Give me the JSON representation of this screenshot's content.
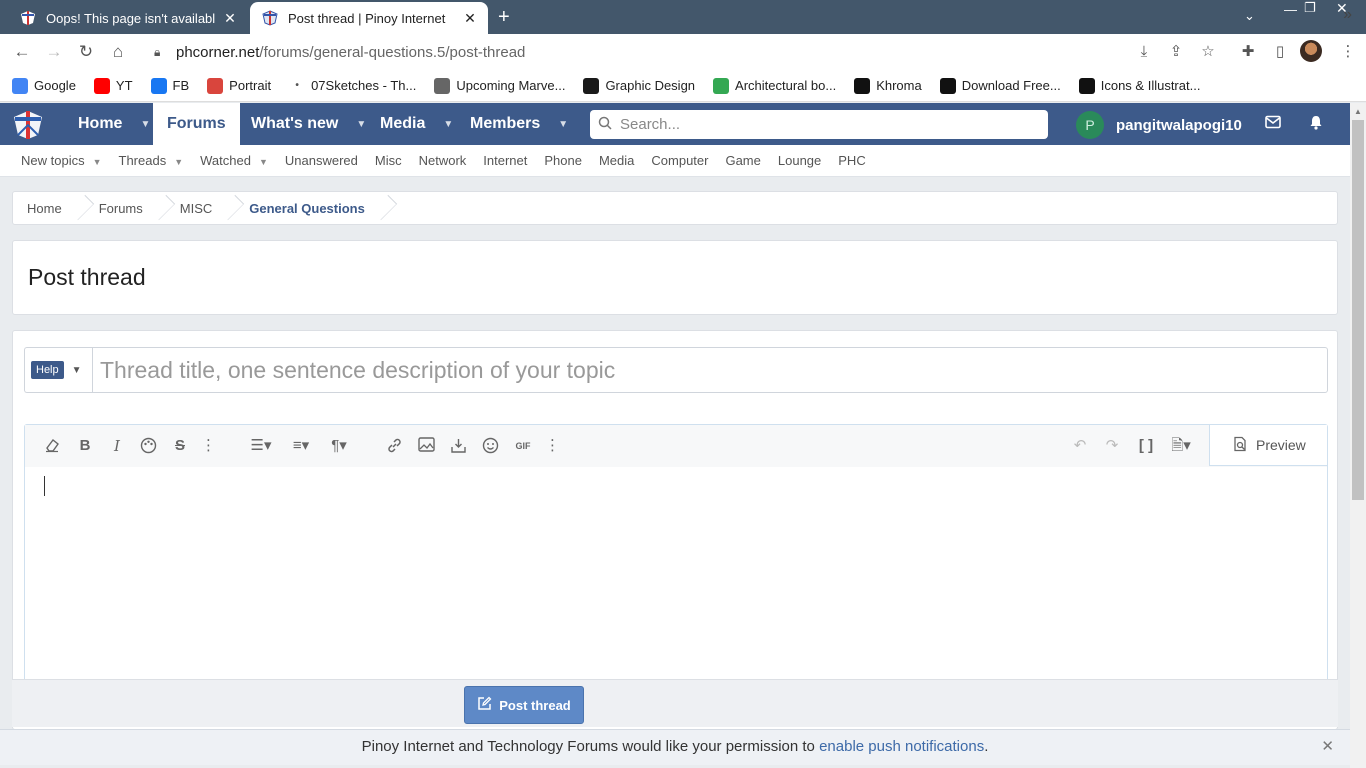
{
  "browser": {
    "tabs": [
      {
        "title": "Oops! This page isn't availabl",
        "active": false
      },
      {
        "title": "Post thread | Pinoy Internet",
        "active": true
      }
    ],
    "url_host": "phcorner.net",
    "url_path": "/forums/general-questions.5/post-thread",
    "bookmarks": [
      {
        "label": "Google",
        "icon": "google-icon",
        "color": "#4285f4"
      },
      {
        "label": "YT",
        "icon": "youtube-icon",
        "color": "#ff0000"
      },
      {
        "label": "FB",
        "icon": "facebook-icon",
        "color": "#1877f2"
      },
      {
        "label": "Portrait",
        "icon": "portrait-icon",
        "color": "#d9453d"
      },
      {
        "label": "07Sketches - Th...",
        "icon": "dot-icon",
        "color": "#555555"
      },
      {
        "label": "Upcoming Marve...",
        "icon": "marvel-icon",
        "color": "#666666"
      },
      {
        "label": "Graphic Design",
        "icon": "graphic-design-icon",
        "color": "#1a1a1a"
      },
      {
        "label": "Architectural bo...",
        "icon": "drive-icon",
        "color": "#34a853"
      },
      {
        "label": "Khroma",
        "icon": "khroma-icon",
        "color": "#111111"
      },
      {
        "label": "Download Free...",
        "icon": "download-icon",
        "color": "#111111"
      },
      {
        "label": "Icons & Illustrat...",
        "icon": "icons-icon",
        "color": "#111111"
      }
    ]
  },
  "site": {
    "nav": [
      {
        "label": "Home",
        "caret": true
      },
      {
        "label": "Forums",
        "caret": false,
        "active": true
      },
      {
        "label": "What's new",
        "caret": true
      },
      {
        "label": "Media",
        "caret": true
      },
      {
        "label": "Members",
        "caret": true
      }
    ],
    "search_placeholder": "Search...",
    "username": "pangitwalapogi10",
    "avatar_letter": "P",
    "subnav": [
      "New topics",
      "Threads",
      "Watched",
      "Unanswered",
      "Misc",
      "Network",
      "Internet",
      "Phone",
      "Media",
      "Computer",
      "Game",
      "Lounge",
      "PHC"
    ],
    "breadcrumbs": [
      "Home",
      "Forums",
      "MISC",
      "General Questions"
    ],
    "page_title": "Post thread",
    "prefix_label": "Help",
    "title_placeholder": "Thread title, one sentence description of your topic",
    "preview_label": "Preview",
    "submit_label": "Post thread",
    "notice_text": "Pinoy Internet and Technology Forums would like your permission to ",
    "notice_link": "enable push notifications",
    "notice_end": ".",
    "colors": {
      "brand": "#3d5a8a",
      "button": "#5e89c7"
    }
  }
}
